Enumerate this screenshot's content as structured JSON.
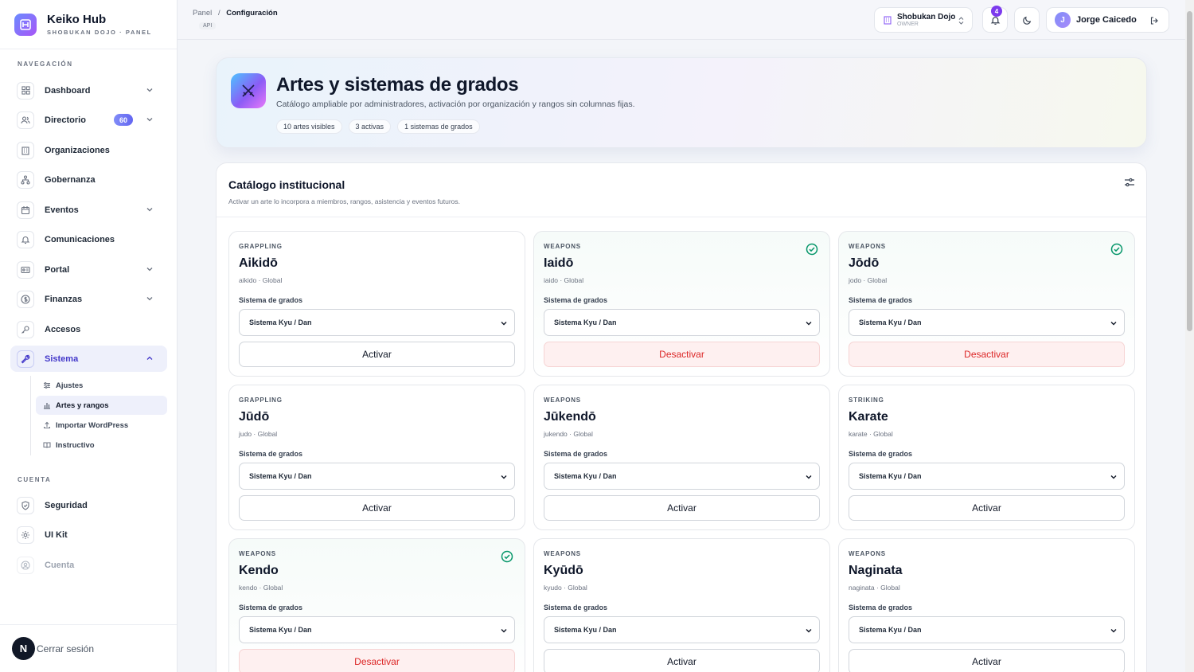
{
  "brand": {
    "title": "Keiko Hub",
    "subtitle": "SHOBUKAN DOJO · PANEL"
  },
  "sidebar": {
    "nav_heading": "NAVEGACIÓN",
    "items": [
      {
        "label": "Dashboard",
        "icon": "grid-icon"
      },
      {
        "label": "Directorio",
        "icon": "users-icon",
        "badge": "60"
      },
      {
        "label": "Organizaciones",
        "icon": "building-icon"
      },
      {
        "label": "Gobernanza",
        "icon": "hierarchy-icon"
      },
      {
        "label": "Eventos",
        "icon": "calendar-icon"
      },
      {
        "label": "Comunicaciones",
        "icon": "bell-icon"
      },
      {
        "label": "Portal",
        "icon": "id-card-icon"
      },
      {
        "label": "Finanzas",
        "icon": "dollar-icon"
      },
      {
        "label": "Accesos",
        "icon": "key-icon"
      },
      {
        "label": "Sistema",
        "icon": "wrench-icon"
      }
    ],
    "sub_items": [
      {
        "label": "Ajustes",
        "icon": "sliders-icon"
      },
      {
        "label": "Artes y rangos",
        "icon": "bar-chart-icon"
      },
      {
        "label": "Importar WordPress",
        "icon": "upload-icon"
      },
      {
        "label": "Instructivo",
        "icon": "book-icon"
      }
    ],
    "account_heading": "CUENTA",
    "account_items": [
      {
        "label": "Seguridad",
        "icon": "shield-icon"
      },
      {
        "label": "UI Kit",
        "icon": "gear-icon"
      },
      {
        "label": "Cuenta",
        "icon": "user-circle-icon"
      }
    ],
    "logout_label": "Cerrar sesión",
    "logout_avatar": "N"
  },
  "topbar": {
    "crumb_root": "Panel",
    "crumb_sep": "/",
    "crumb_current": "Configuración",
    "api_tag": "API",
    "org_name": "Shobukan Dojo",
    "org_role": "OWNER",
    "notifications": "4",
    "user_initial": "J",
    "user_name": "Jorge Caicedo"
  },
  "hero": {
    "title": "Artes y sistemas de grados",
    "description": "Catálogo ampliable por administradores, activación por organización y rangos sin columnas fijas.",
    "pills": [
      "10 artes visibles",
      "3 activas",
      "1 sistemas de grados"
    ]
  },
  "catalog": {
    "title": "Catálogo institucional",
    "description": "Activar un arte lo incorpora a miembros, rangos, asistencia y eventos futuros.",
    "field_label": "Sistema de grados",
    "activate_label": "Activar",
    "deactivate_label": "Desactivar",
    "cards": [
      {
        "category": "GRAPPLING",
        "name": "Aikidō",
        "meta": "aikido · Global",
        "system": "Sistema Kyu / Dan",
        "active": false
      },
      {
        "category": "WEAPONS",
        "name": "Iaidō",
        "meta": "iaido · Global",
        "system": "Sistema Kyu / Dan",
        "active": true
      },
      {
        "category": "WEAPONS",
        "name": "Jōdō",
        "meta": "jodo · Global",
        "system": "Sistema Kyu / Dan",
        "active": true
      },
      {
        "category": "GRAPPLING",
        "name": "Jūdō",
        "meta": "judo · Global",
        "system": "Sistema Kyu / Dan",
        "active": false
      },
      {
        "category": "WEAPONS",
        "name": "Jūkendō",
        "meta": "jukendo · Global",
        "system": "Sistema Kyu / Dan",
        "active": false
      },
      {
        "category": "STRIKING",
        "name": "Karate",
        "meta": "karate · Global",
        "system": "Sistema Kyu / Dan",
        "active": false
      },
      {
        "category": "WEAPONS",
        "name": "Kendo",
        "meta": "kendo · Global",
        "system": "Sistema Kyu / Dan",
        "active": true
      },
      {
        "category": "WEAPONS",
        "name": "Kyūdō",
        "meta": "kyudo · Global",
        "system": "Sistema Kyu / Dan",
        "active": false
      },
      {
        "category": "WEAPONS",
        "name": "Naginata",
        "meta": "naginata · Global",
        "system": "Sistema Kyu / Dan",
        "active": false
      }
    ]
  },
  "colors": {
    "accent": "#4338ca",
    "active_check": "#059669",
    "danger": "#dc2626"
  }
}
